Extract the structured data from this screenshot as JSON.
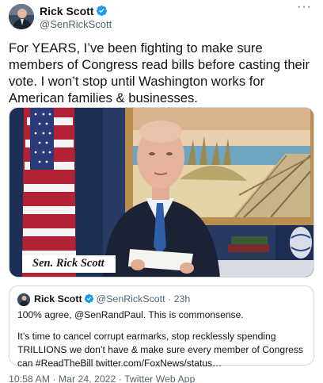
{
  "author": {
    "name": "Rick Scott",
    "handle": "@SenRickScott"
  },
  "menu_icon": "more-horizontal-icon",
  "verified_icon": "verified-badge-icon",
  "tweet_text": "For YEARS, I’ve been fighting to make sure members of Congress read bills before casting their vote. I won’t stop until Washington works for American families & businesses.",
  "media": {
    "caption": "Sen. Rick Scott"
  },
  "quote": {
    "name": "Rick Scott",
    "handle": "@SenRickScott",
    "separator": "·",
    "time": "23h",
    "text_line1": "100% agree, @SenRandPaul. This is commonsense.",
    "text_para2": "It’s time to cancel corrupt earmarks, stop recklessly spending TRILLIONS we don’t have & make sure every member of Congress can #ReadTheBill twitter.com/FoxNews/status…"
  },
  "footer": {
    "timestamp": "10:58 AM · Mar 24, 2022 · Twitter Web App"
  },
  "colors": {
    "verified": "#1d9bf0",
    "secondary_text": "#536471",
    "border": "#cfd9de"
  }
}
